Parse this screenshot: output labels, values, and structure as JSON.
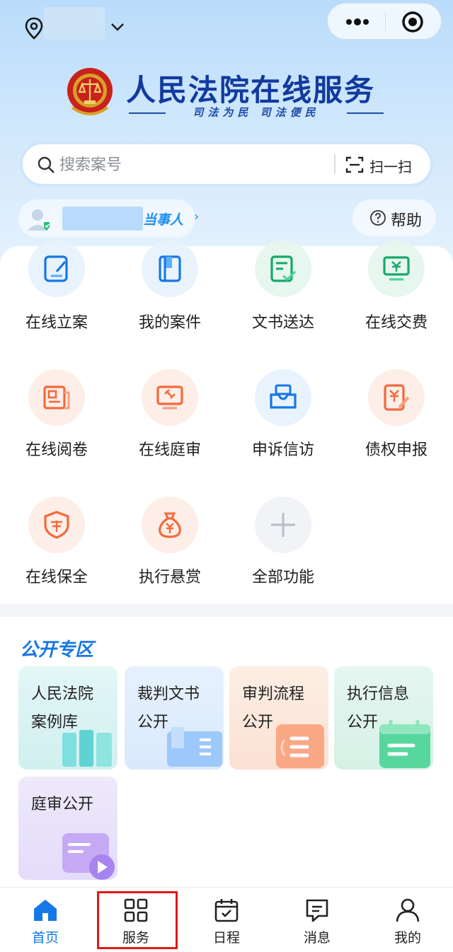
{
  "header": {
    "location_icon": "location-pin-icon",
    "more_icon": "more-dots-icon",
    "close_icon": "target-close-icon"
  },
  "brand": {
    "title": "人民法院在线服务",
    "slogan": "司法为民  司法便民",
    "emblem_icon": "court-emblem-icon"
  },
  "search": {
    "placeholder": "搜索案号",
    "scan_label": "扫一扫"
  },
  "user": {
    "role": "当事人",
    "arrow": "›"
  },
  "help": {
    "label": "帮助"
  },
  "services": [
    {
      "label": "在线立案",
      "icon": "edit-doc-icon",
      "color": "#1677e6"
    },
    {
      "label": "我的案件",
      "icon": "book-icon",
      "color": "#1677e6"
    },
    {
      "label": "文书送达",
      "icon": "doc-check-icon",
      "color": "#18a868"
    },
    {
      "label": "在线交费",
      "icon": "yuan-monitor-icon",
      "color": "#18a868"
    },
    {
      "label": "在线阅卷",
      "icon": "newspaper-icon",
      "color": "#f26a3c"
    },
    {
      "label": "在线庭审",
      "icon": "gavel-screen-icon",
      "color": "#f26a3c"
    },
    {
      "label": "申诉信访",
      "icon": "inbox-icon",
      "color": "#1677e6"
    },
    {
      "label": "债权申报",
      "icon": "yuan-edit-icon",
      "color": "#f26a3c"
    },
    {
      "label": "在线保全",
      "icon": "shield-bao-icon",
      "color": "#f26a3c"
    },
    {
      "label": "执行悬赏",
      "icon": "money-bag-icon",
      "color": "#f26a3c"
    },
    {
      "label": "全部功能",
      "icon": "plus-icon",
      "color": "#b9c0ca"
    }
  ],
  "public_zone": {
    "title": "公开专区",
    "cards": [
      {
        "line1": "人民法院",
        "line2": "案例库"
      },
      {
        "line1": "裁判文书",
        "line2": "公开"
      },
      {
        "line1": "审判流程",
        "line2": "公开"
      },
      {
        "line1": "执行信息",
        "line2": "公开"
      },
      {
        "line1": "庭审公开",
        "line2": ""
      }
    ]
  },
  "tabs": [
    {
      "label": "首页",
      "icon": "home-icon",
      "active": true
    },
    {
      "label": "服务",
      "icon": "grid-icon",
      "active": false
    },
    {
      "label": "日程",
      "icon": "calendar-check-icon",
      "active": false
    },
    {
      "label": "消息",
      "icon": "message-icon",
      "active": false
    },
    {
      "label": "我的",
      "icon": "user-icon",
      "active": false
    }
  ],
  "colors": {
    "primary": "#1677e6",
    "brand_title": "#123a9e",
    "highlight": "#e01818"
  }
}
